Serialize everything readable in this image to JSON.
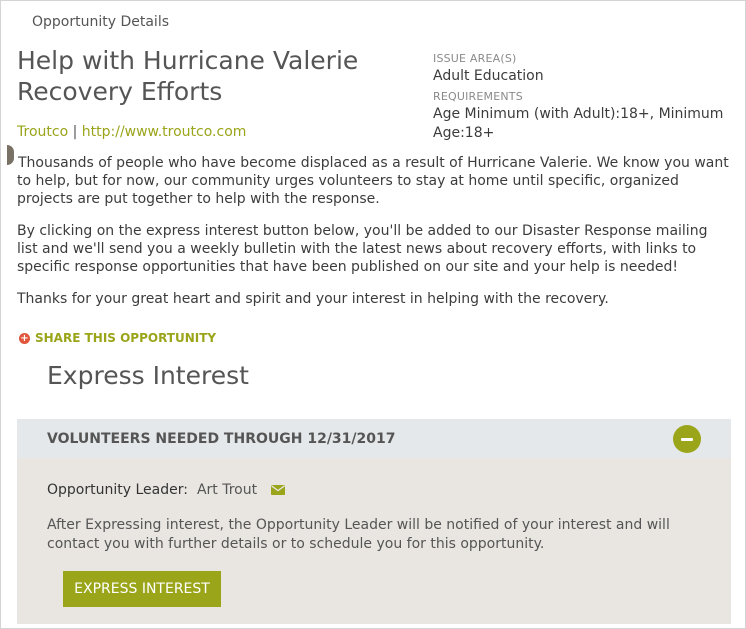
{
  "page": {
    "header": "Opportunity Details",
    "title": "Help with Hurricane Valerie Recovery Efforts"
  },
  "organization": {
    "name": "Troutco",
    "separator": "|",
    "url": "http://www.troutco.com"
  },
  "details": {
    "issue_area_label": "ISSUE AREA(S)",
    "issue_area_value": "Adult Education",
    "requirements_label": "REQUIREMENTS",
    "requirements_value": "Age Minimum (with Adult):18+, Minimum Age:18+"
  },
  "description": {
    "p1": "Thousands of people who have become displaced as a result of Hurricane Valerie. We know you want to help, but for now, our community urges volunteers to stay at home until specific, organized projects are put together to help with the response.",
    "p2": "By clicking on the express interest button below, you'll be added to our Disaster Response mailing list and we'll send you a weekly bulletin with the latest news about recovery efforts, with links to specific response opportunities that have been published on our site and your help is needed!",
    "p3": "Thanks for your great heart and spirit and your interest in helping with the recovery."
  },
  "share": {
    "label": "SHARE THIS OPPORTUNITY"
  },
  "express": {
    "heading": "Express Interest",
    "panel_header": "VOLUNTEERS NEEDED THROUGH 12/31/2017",
    "leader_label": "Opportunity Leader:",
    "leader_name": "Art Trout",
    "notice": "After Expressing interest, the Opportunity Leader will be notified of your interest and will contact you with further details or to schedule you for this opportunity.",
    "button_label": "EXPRESS INTEREST"
  },
  "colors": {
    "accent": "#9aa51a",
    "share_icon": "#e0553b",
    "panel_bg": "#e9e6e2",
    "panel_header_bg": "#e4e8ea"
  }
}
